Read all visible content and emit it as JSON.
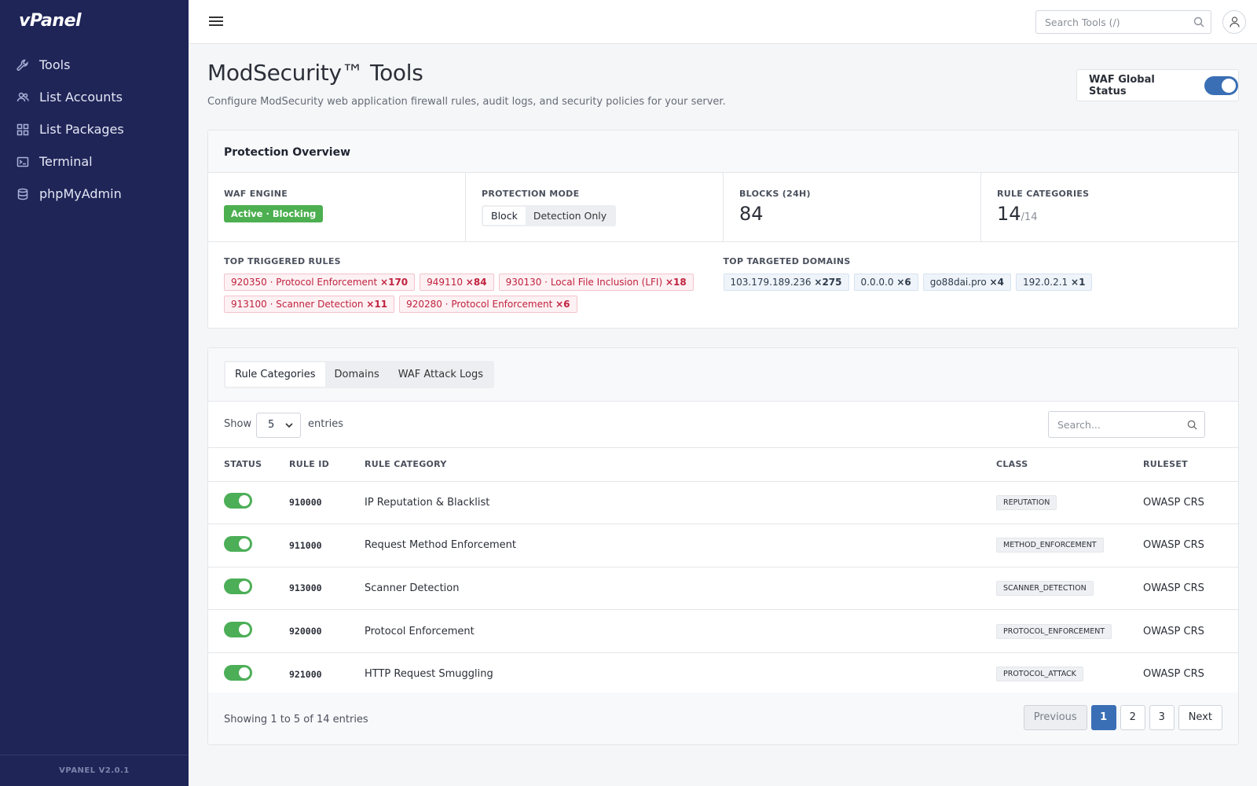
{
  "app": {
    "logo": "vPanel",
    "version": "VPANEL V2.0.1"
  },
  "sidebar": {
    "items": [
      {
        "label": "Tools",
        "icon": "wrench-icon"
      },
      {
        "label": "List Accounts",
        "icon": "users-icon"
      },
      {
        "label": "List Packages",
        "icon": "grid-icon"
      },
      {
        "label": "Terminal",
        "icon": "terminal-icon"
      },
      {
        "label": "phpMyAdmin",
        "icon": "database-icon"
      }
    ]
  },
  "topbar": {
    "search_placeholder": "Search Tools (/)"
  },
  "header": {
    "title": "ModSecurity™ Tools",
    "subtitle": "Configure ModSecurity web application firewall rules, audit logs, and security policies for your server.",
    "waf_global_label": "WAF Global Status",
    "waf_global_on": true
  },
  "overview": {
    "title": "Protection Overview",
    "engine_label": "WAF ENGINE",
    "engine_status": "Active · Blocking",
    "mode_label": "PROTECTION MODE",
    "mode_options": [
      "Block",
      "Detection Only"
    ],
    "mode_selected": "Block",
    "blocks_label": "BLOCKS (24H)",
    "blocks_value": "84",
    "categories_label": "RULE CATEGORIES",
    "categories_value": "14",
    "categories_total": "/14",
    "top_rules_label": "TOP TRIGGERED RULES",
    "top_rules": [
      {
        "text": "920350 · Protocol Enforcement",
        "count": "×170"
      },
      {
        "text": "949110",
        "count": "×84"
      },
      {
        "text": "930130 · Local File Inclusion (LFI)",
        "count": "×18"
      },
      {
        "text": "913100 · Scanner Detection",
        "count": "×11"
      },
      {
        "text": "920280 · Protocol Enforcement",
        "count": "×6"
      }
    ],
    "top_domains_label": "TOP TARGETED DOMAINS",
    "top_domains": [
      {
        "text": "103.179.189.236",
        "count": "×275"
      },
      {
        "text": "0.0.0.0",
        "count": "×6"
      },
      {
        "text": "go88dai.pro",
        "count": "×4"
      },
      {
        "text": "192.0.2.1",
        "count": "×1"
      }
    ]
  },
  "tabs": {
    "items": [
      "Rule Categories",
      "Domains",
      "WAF Attack Logs"
    ],
    "active": "Rule Categories"
  },
  "table": {
    "show_label": "Show",
    "page_size": "5",
    "entries_label": "entries",
    "search_placeholder": "Search...",
    "columns": [
      "STATUS",
      "RULE ID",
      "RULE CATEGORY",
      "CLASS",
      "RULESET"
    ],
    "rows": [
      {
        "enabled": true,
        "rule_id": "910000",
        "category": "IP Reputation & Blacklist",
        "class": "REPUTATION",
        "ruleset": "OWASP CRS"
      },
      {
        "enabled": true,
        "rule_id": "911000",
        "category": "Request Method Enforcement",
        "class": "METHOD_ENFORCEMENT",
        "ruleset": "OWASP CRS"
      },
      {
        "enabled": true,
        "rule_id": "913000",
        "category": "Scanner Detection",
        "class": "SCANNER_DETECTION",
        "ruleset": "OWASP CRS"
      },
      {
        "enabled": true,
        "rule_id": "920000",
        "category": "Protocol Enforcement",
        "class": "PROTOCOL_ENFORCEMENT",
        "ruleset": "OWASP CRS"
      },
      {
        "enabled": true,
        "rule_id": "921000",
        "category": "HTTP Request Smuggling",
        "class": "PROTOCOL_ATTACK",
        "ruleset": "OWASP CRS"
      }
    ],
    "showing_text": "Showing 1 to 5 of 14 entries",
    "pagination": {
      "previous": "Previous",
      "pages": [
        "1",
        "2",
        "3"
      ],
      "current": "1",
      "next": "Next"
    }
  },
  "colors": {
    "sidebar_bg": "#1f2557",
    "accent_blue": "#3a6fb5",
    "success_green": "#4caf50",
    "danger_red": "#c0223f"
  }
}
